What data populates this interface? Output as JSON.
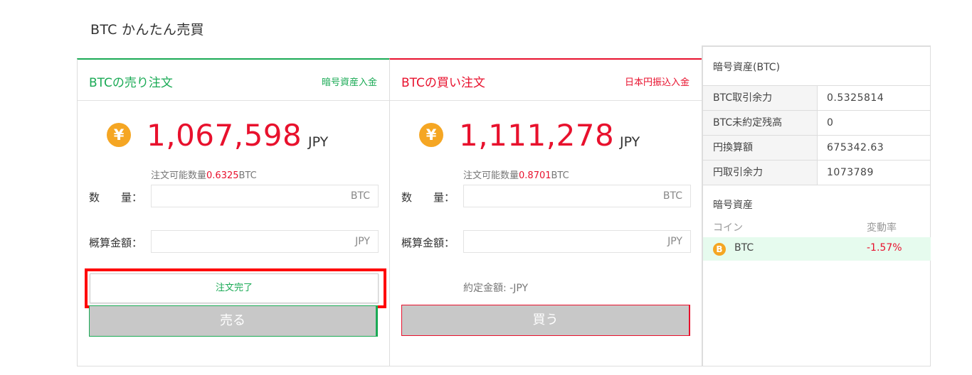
{
  "page": {
    "title": "BTC かんたん売買"
  },
  "sell": {
    "title": "BTCの売り注文",
    "link": "暗号資産入金",
    "price": "1,067,598",
    "price_unit": "JPY",
    "avail_label": "注文可能数量",
    "avail_value": "0.6325",
    "avail_unit": "BTC",
    "qty_label": "数　　量：",
    "qty_unit": "BTC",
    "est_label": "概算金額：",
    "est_unit": "JPY",
    "complete_label": "注文完了",
    "action_label": "売る"
  },
  "buy": {
    "title": "BTCの買い注文",
    "link": "日本円振込入金",
    "price": "1,111,278",
    "price_unit": "JPY",
    "avail_label": "注文可能数量",
    "avail_value": "0.8701",
    "avail_unit": "BTC",
    "qty_label": "数　　量：",
    "qty_unit": "BTC",
    "est_label": "概算金額：",
    "est_unit": "JPY",
    "contract": "約定金額: -JPY",
    "action_label": "買う"
  },
  "side": {
    "title": "暗号資産(BTC)",
    "rows": [
      {
        "label": "BTC取引余力",
        "value": "0.5325814"
      },
      {
        "label": "BTC未約定残高",
        "value": "0"
      },
      {
        "label": "円換算額",
        "value": "675342.63"
      },
      {
        "label": "円取引余力",
        "value": "1073789"
      }
    ],
    "assets_title": "暗号資産",
    "col_coin": "コイン",
    "col_change": "変動率",
    "assets": [
      {
        "name": "BTC",
        "change": "-1.57%",
        "icon": "B"
      }
    ]
  },
  "icons": {
    "yen": "¥"
  },
  "colors": {
    "sell": "#1aaa55",
    "buy": "#e8112d",
    "coin": "#f5a623",
    "highlight": "#ff0000"
  }
}
